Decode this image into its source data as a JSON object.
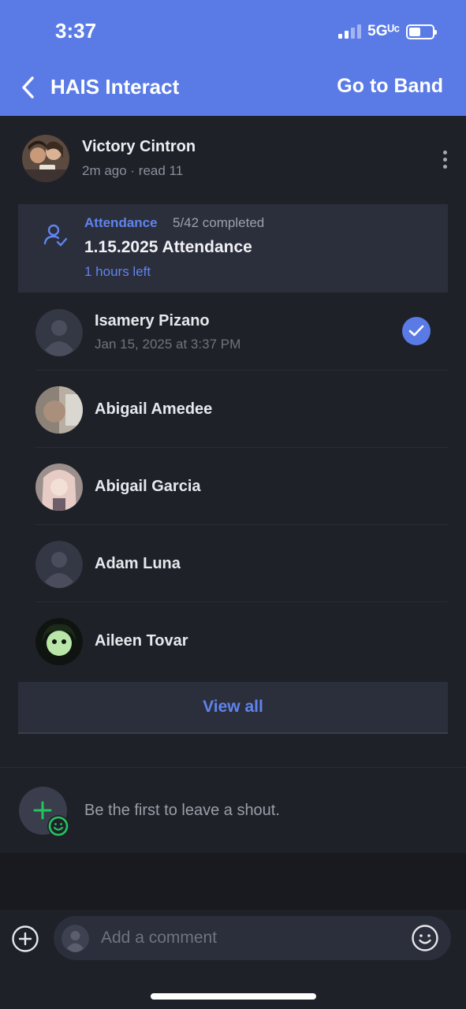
{
  "status_bar": {
    "time": "3:37",
    "network": "5Gᵁᶜ",
    "battery_level": 0.5
  },
  "nav": {
    "title": "HAIS Interact",
    "action": "Go to Band"
  },
  "post": {
    "author": "Victory Cintron",
    "meta": "2m ago · read 11"
  },
  "attendance": {
    "label": "Attendance",
    "count": "5/42 completed",
    "title": "1.15.2025 Attendance",
    "time_left": "1 hours left"
  },
  "members": [
    {
      "name": "Isamery Pizano",
      "date": "Jan 15, 2025 at 3:37 PM",
      "checked": true
    },
    {
      "name": "Abigail Amedee"
    },
    {
      "name": "Abigail Garcia"
    },
    {
      "name": "Adam Luna"
    },
    {
      "name": "Aileen Tovar"
    }
  ],
  "view_all": "View all",
  "shout": {
    "placeholder": "Be the first to leave a shout."
  },
  "comment": {
    "placeholder": "Add a comment"
  },
  "colors": {
    "accent": "#5a7be6",
    "link": "#5f84ee",
    "background": "#1f2129",
    "card": "#2b2e3b",
    "shout_green": "#22c55e"
  }
}
